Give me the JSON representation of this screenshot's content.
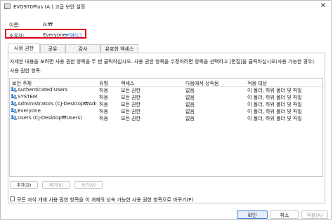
{
  "window": {
    "title": "EVO970Plus (A:) 고급 보안 설정",
    "close_glyph": "✕"
  },
  "info": {
    "name_label": "이름:",
    "name_value": "A:₩",
    "owner_label": "소유자:",
    "owner_value": "Everyone",
    "owner_change": "변경(C)"
  },
  "tabs": [
    "사용 권한",
    "공유",
    "감사",
    "유효한 액세스"
  ],
  "permissions": {
    "description": "자세한 내용을 보려면 사용 권한 항목을 두 번 클릭하십시오. 사용 권한 항목을 수정하려면 항목을 선택하고 [편집]을 클릭하십시오(사용 가능한 경우).",
    "heading": "사용 권한 항목:",
    "columns": [
      "보안 주체",
      "유형",
      "액세스",
      "다음에서 상속됨",
      "적용 대상"
    ],
    "rows": [
      {
        "principal": "Authenticated Users",
        "type": "허용",
        "access": "모든 권한",
        "inherited": "없음",
        "applies": "이 폴더, 하위 폴더 및 파일"
      },
      {
        "principal": "SYSTEM",
        "type": "허용",
        "access": "모든 권한",
        "inherited": "없음",
        "applies": "이 폴더, 하위 폴더 및 파일"
      },
      {
        "principal": "Administrators (CJ-Desktop₩Adminis...",
        "type": "허용",
        "access": "모든 권한",
        "inherited": "없음",
        "applies": "이 폴더, 하위 폴더 및 파일"
      },
      {
        "principal": "Everyone",
        "type": "허용",
        "access": "모든 권한",
        "inherited": "없음",
        "applies": "이 폴더, 하위 폴더 및 파일"
      },
      {
        "principal": "Users (CJ-Desktop₩Users)",
        "type": "허용",
        "access": "모든 권한",
        "inherited": "없음",
        "applies": "이 폴더, 하위 폴더 및 파일"
      }
    ],
    "add_label": "추가(D)",
    "remove_label": "제거(R)",
    "view_label": "보기(V)",
    "replace_label": "모든 자식 개체 사용 권한 항목을 이 개체의 상속 가능한 사용 권한 항목으로 바꾸기(P)"
  },
  "footer": {
    "ok_label": "확인",
    "cancel_label": "취소",
    "apply_label": "적용(A)"
  },
  "colors": {
    "highlight_border": "#e0001a",
    "link": "#0a58b5",
    "primary_button": "#e6eefb"
  },
  "icons": {
    "principal": "users-icon",
    "window": "drive-icon",
    "close": "close-icon"
  }
}
